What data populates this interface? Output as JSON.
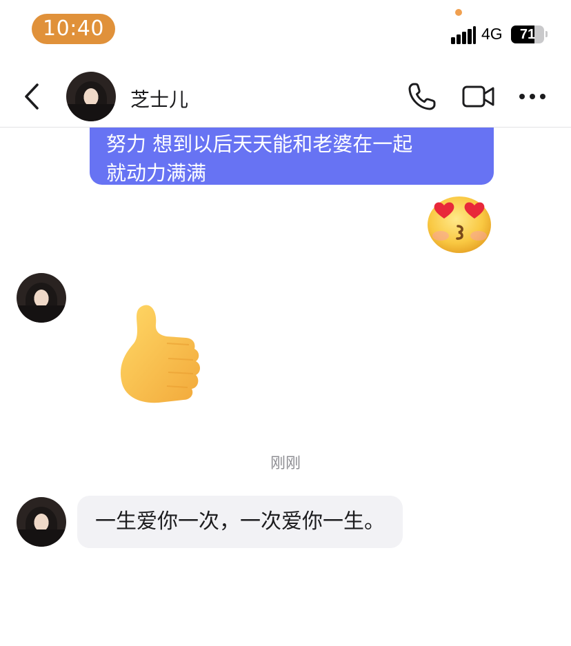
{
  "status_bar": {
    "time": "10:40",
    "network": "4G",
    "battery": "71",
    "battery_level": 0.71
  },
  "header": {
    "contact_name": "芝士儿",
    "icons": [
      "back-icon",
      "avatar",
      "phone-icon",
      "video-icon",
      "more-icon"
    ]
  },
  "messages": {
    "outgoing_text": "努力 想到以后天天能和老婆在一起就动力满满",
    "outgoing_line1": "努力 想到以后天天能和老婆在一起",
    "outgoing_line2": "就动力满满",
    "kiss_emoji": "heart-eyes-kiss-emoji",
    "thumbs_sticker": "thumbs-up-sticker",
    "timestamp": "刚刚",
    "incoming_text": "一生爱你一次，一次爱你一生。"
  },
  "colors": {
    "time_pill": "#e0913a",
    "outgoing_bubble": "#6773f3",
    "incoming_bubble": "#f2f2f5",
    "timestamp": "#8e8e93"
  }
}
